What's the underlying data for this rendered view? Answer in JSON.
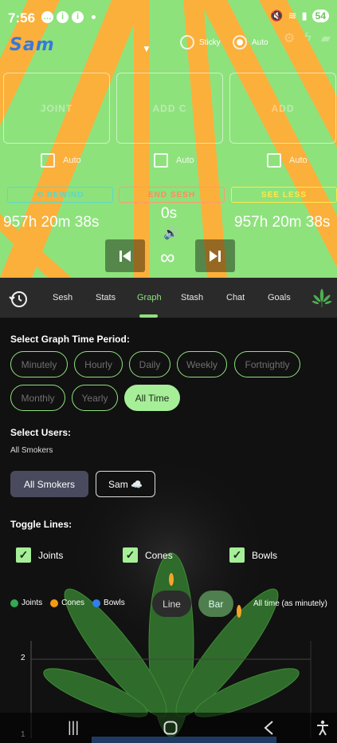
{
  "status_bar": {
    "time": "7:56",
    "battery": "54"
  },
  "header": {
    "logo": "Sam",
    "sticky_label": "Sticky",
    "auto_label": "Auto"
  },
  "cards": [
    {
      "label": "JOINT"
    },
    {
      "label": "ADD C"
    },
    {
      "label": "ADD"
    }
  ],
  "auto_checks": [
    "Auto",
    "Auto",
    "Auto"
  ],
  "actions": {
    "rewind": "⟲ REWIND",
    "end_sesh": "END SESH",
    "see_less": "SEE LESS"
  },
  "timers": {
    "left": "957h 20m 38s",
    "center": "0s",
    "right": "957h 20m 38s",
    "infinity": "∞"
  },
  "tabs": [
    {
      "label": "Sesh"
    },
    {
      "label": "Stats"
    },
    {
      "label": "Graph"
    },
    {
      "label": "Stash"
    },
    {
      "label": "Chat"
    },
    {
      "label": "Goals"
    }
  ],
  "graph_panel": {
    "period_title": "Select Graph Time Period:",
    "periods": [
      "Minutely",
      "Hourly",
      "Daily",
      "Weekly",
      "Fortnightly",
      "Monthly",
      "Yearly",
      "All Time"
    ],
    "selected_period": "All Time",
    "users_title": "Select Users:",
    "users_subtitle": "All Smokers",
    "user_all": "All Smokers",
    "user_sam": "Sam ☁️",
    "toggle_title": "Toggle Lines:",
    "toggles": [
      "Joints",
      "Cones",
      "Bowls"
    ],
    "legend": [
      {
        "label": "Joints",
        "color": "#34a853"
      },
      {
        "label": "Cones",
        "color": "#f39c12"
      },
      {
        "label": "Bowls",
        "color": "#2f80ed"
      }
    ],
    "chart_types": [
      "Line",
      "Bar"
    ],
    "selected_chart_type": "Bar",
    "period_label": "All time (as minutely)",
    "y_ticks": [
      "2",
      "1"
    ]
  },
  "colors": {
    "accent": "#8ee27c",
    "stripe": "#fbb03b"
  }
}
